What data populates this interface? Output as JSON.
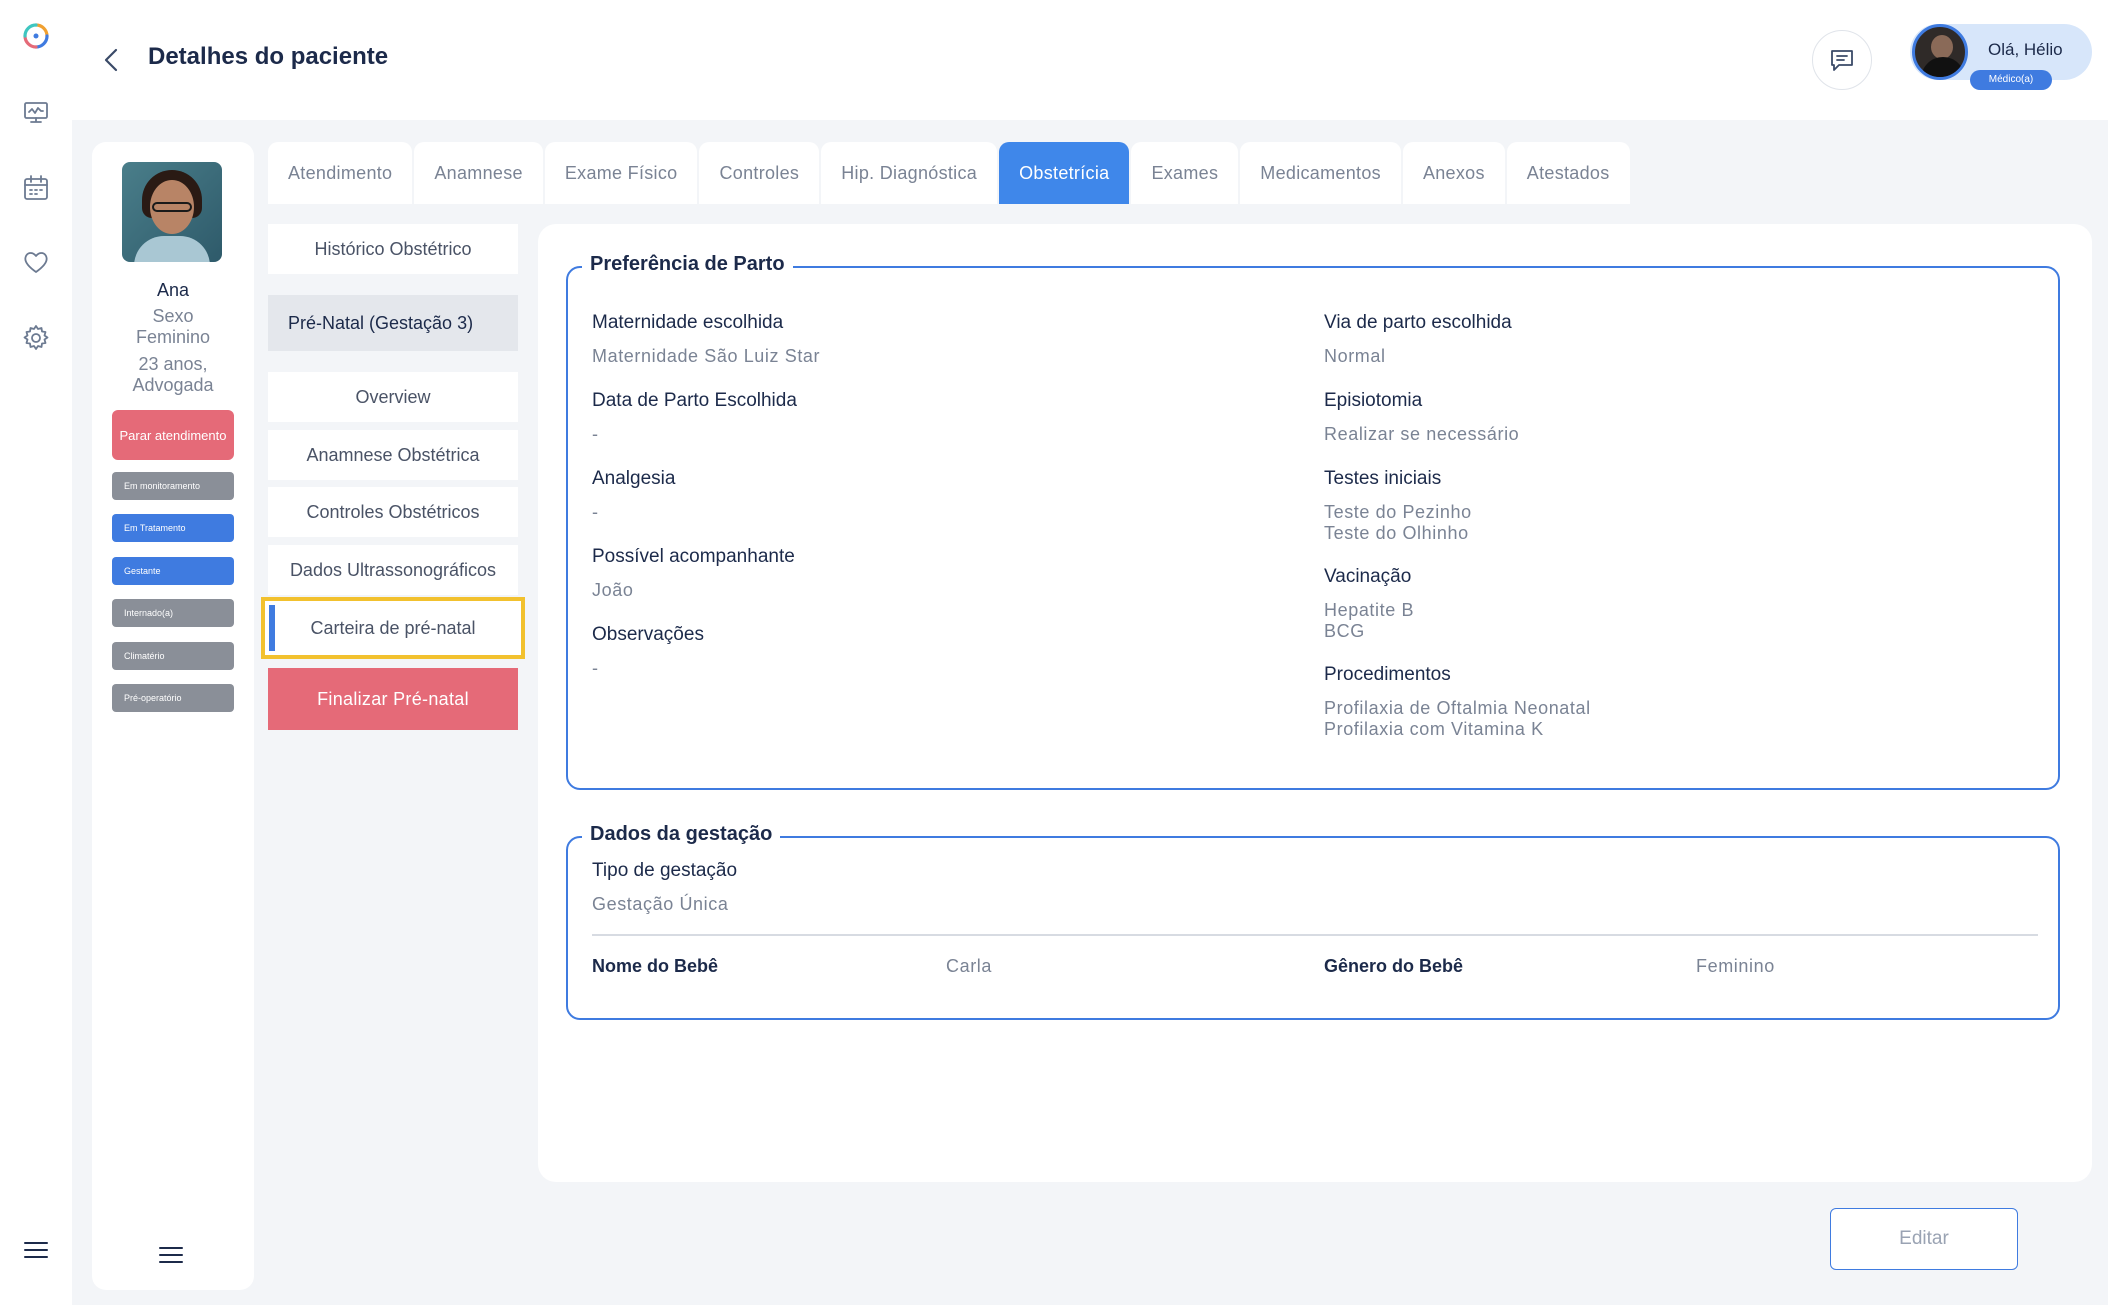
{
  "header": {
    "title": "Detalhes do paciente",
    "user_greeting": "Olá, Hélio",
    "user_role": "Médico(a)"
  },
  "patient": {
    "name": "Ana",
    "sex_label": "Sexo",
    "sex": "Feminino",
    "age": "23 anos,",
    "profession": "Advogada",
    "stop_button": "Parar atendimento",
    "tags": [
      {
        "label": "Em monitoramento",
        "color": "#8a8f98"
      },
      {
        "label": "Em Tratamento",
        "color": "#3f7be0"
      },
      {
        "label": "Gestante",
        "color": "#3f7be0"
      },
      {
        "label": "Internado(a)",
        "color": "#8a8f98"
      },
      {
        "label": "Climatério",
        "color": "#8a8f98"
      },
      {
        "label": "Pré-operatório",
        "color": "#8a8f98"
      }
    ]
  },
  "tabs": [
    {
      "label": "Atendimento"
    },
    {
      "label": "Anamnese"
    },
    {
      "label": "Exame Físico"
    },
    {
      "label": "Controles"
    },
    {
      "label": "Hip. Diagnóstica"
    },
    {
      "label": "Obstetrícia",
      "active": true
    },
    {
      "label": "Exames"
    },
    {
      "label": "Medicamentos"
    },
    {
      "label": "Anexos"
    },
    {
      "label": "Atestados"
    }
  ],
  "submenu": {
    "historico": "Histórico Obstétrico",
    "prenatal": "Pré-Natal (Gestação 3)",
    "overview": "Overview",
    "anamnese_obstetrica": "Anamnese Obstétrica",
    "controles_obstetricos": "Controles Obstétricos",
    "dados_ultrasso": "Dados Ultrassonográficos",
    "carteira": "Carteira de pré-natal",
    "finalizar": "Finalizar Pré-natal"
  },
  "preferencia": {
    "title": "Preferência de Parto",
    "maternidade_label": "Maternidade escolhida",
    "maternidade_value": "Maternidade São Luiz Star",
    "data_parto_label": "Data de Parto Escolhida",
    "data_parto_value": "-",
    "analgesia_label": "Analgesia",
    "analgesia_value": "-",
    "acompanhante_label": "Possível acompanhante",
    "acompanhante_value": "João",
    "observacoes_label": "Observações",
    "observacoes_value": "-",
    "via_parto_label": "Via de parto escolhida",
    "via_parto_value": "Normal",
    "episiotomia_label": "Episiotomia",
    "episiotomia_value": "Realizar se necessário",
    "testes_label": "Testes iniciais",
    "testes_value_1": "Teste do Pezinho",
    "testes_value_2": "Teste do Olhinho",
    "vacinacao_label": "Vacinação",
    "vacinacao_value_1": "Hepatite B",
    "vacinacao_value_2": "BCG",
    "procedimentos_label": "Procedimentos",
    "procedimentos_value_1": "Profilaxia de Oftalmia Neonatal",
    "procedimentos_value_2": "Profilaxia com Vitamina K"
  },
  "gestacao": {
    "title": "Dados da gestação",
    "tipo_label": "Tipo de gestação",
    "tipo_value": "Gestação Única",
    "nome_bebe_label": "Nome do Bebê",
    "nome_bebe_value": "Carla",
    "genero_bebe_label": "Gênero do Bebê",
    "genero_bebe_value": "Feminino"
  },
  "actions": {
    "edit": "Editar"
  }
}
